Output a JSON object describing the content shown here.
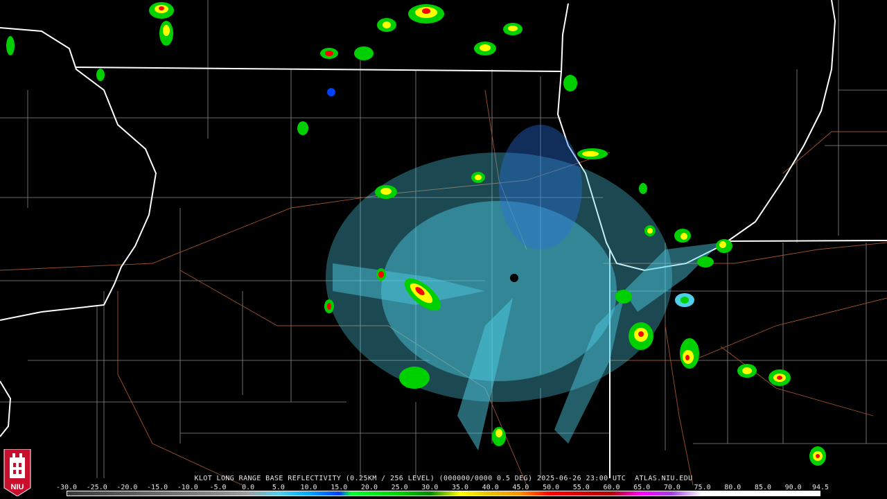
{
  "caption": "KLOT LONG RANGE BASE REFLECTIVITY (0.25KM / 256 LEVEL) (000000/0000 0.5 DEG) 2025-06-26 23:00 UTC  ATLAS.NIU.EDU",
  "logo": {
    "text": "NIU",
    "name": "NIU logo"
  },
  "colorbar": {
    "labels": [
      "-30.0",
      "-25.0",
      "-20.0",
      "-15.0",
      "-10.0",
      "-5.0",
      "0.0",
      "5.0",
      "10.0",
      "15.0",
      "20.0",
      "25.0",
      "30.0",
      "35.0",
      "40.0",
      "45.0",
      "50.0",
      "55.0",
      "60.0",
      "65.0",
      "70.0",
      "75.0",
      "80.0",
      "85.0",
      "90.0",
      "94.5"
    ],
    "stops": [
      {
        "v": -30,
        "c": "#3a3a3a"
      },
      {
        "v": -5,
        "c": "#8a8a8a"
      },
      {
        "v": 0,
        "c": "#9fa0a0"
      },
      {
        "v": 5,
        "c": "#4fd0e8"
      },
      {
        "v": 10,
        "c": "#00a8ff"
      },
      {
        "v": 15,
        "c": "#0040ff"
      },
      {
        "v": 17,
        "c": "#00ff30"
      },
      {
        "v": 25,
        "c": "#00d000"
      },
      {
        "v": 30,
        "c": "#008a00"
      },
      {
        "v": 35,
        "c": "#ffff00"
      },
      {
        "v": 40,
        "c": "#e6c000"
      },
      {
        "v": 45,
        "c": "#ff9000"
      },
      {
        "v": 50,
        "c": "#ff0000"
      },
      {
        "v": 55,
        "c": "#d40000"
      },
      {
        "v": 60,
        "c": "#b00000"
      },
      {
        "v": 65,
        "c": "#ff00ff"
      },
      {
        "v": 70,
        "c": "#a040e0"
      },
      {
        "v": 75,
        "c": "#ffffff"
      },
      {
        "v": 94.5,
        "c": "#ffffff"
      }
    ]
  },
  "colors": {
    "background": "#000000",
    "state_border": "#ffffff",
    "county_border": "#8c8c8c",
    "highway": "#a0522d",
    "radar_weak": "#4fd0e8",
    "radar_mid": "#0040ff",
    "radar_green": "#00d000",
    "radar_yellow": "#ffff00",
    "radar_red": "#ff0000"
  }
}
